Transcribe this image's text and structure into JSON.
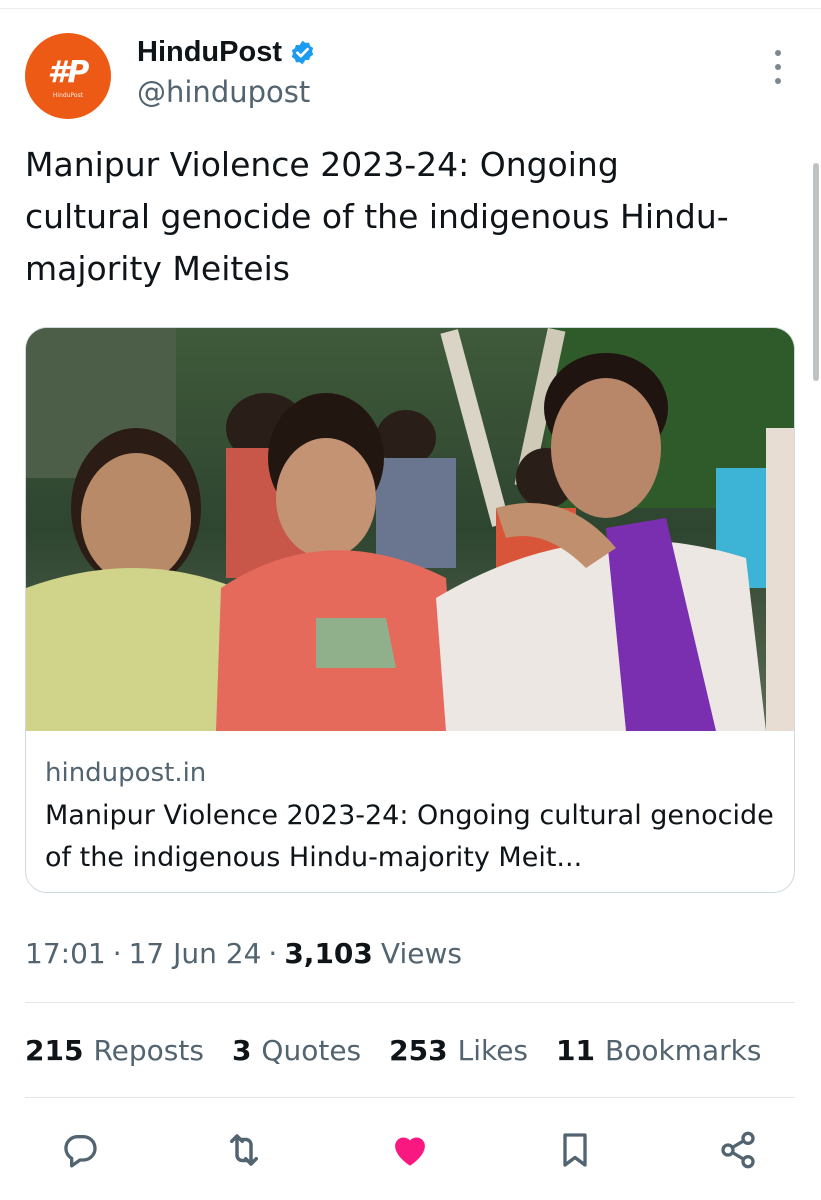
{
  "author": {
    "display_name": "HinduPost",
    "handle": "@hindupost",
    "avatar_text": "#P",
    "avatar_subtext": "HinduPost",
    "verified_icon": "verified-badge-icon"
  },
  "tweet": {
    "text": "Manipur Violence 2023-24: Ongoing cultural genocide of the indigenous Hindu-majority Meiteis",
    "time": "17:01",
    "date": "17 Jun 24",
    "views_count": "3,103",
    "views_label": "Views",
    "separator": "·"
  },
  "card": {
    "domain": "hindupost.in",
    "title": "Manipur Violence 2023-24: Ongoing cultural genocide of the indigenous Hindu-majority Meit..."
  },
  "stats": {
    "reposts_count": "215",
    "reposts_label": "Reposts",
    "quotes_count": "3",
    "quotes_label": "Quotes",
    "likes_count": "253",
    "likes_label": "Likes",
    "bookmarks_count": "11",
    "bookmarks_label": "Bookmarks"
  },
  "actions": [
    "reply-icon",
    "repost-icon",
    "like-icon",
    "bookmark-icon",
    "share-icon"
  ],
  "colors": {
    "text": "#0f1419",
    "secondary": "#536471",
    "verified": "#1d9bf0",
    "like": "#f91880",
    "avatar_bg": "#ec5a16"
  }
}
